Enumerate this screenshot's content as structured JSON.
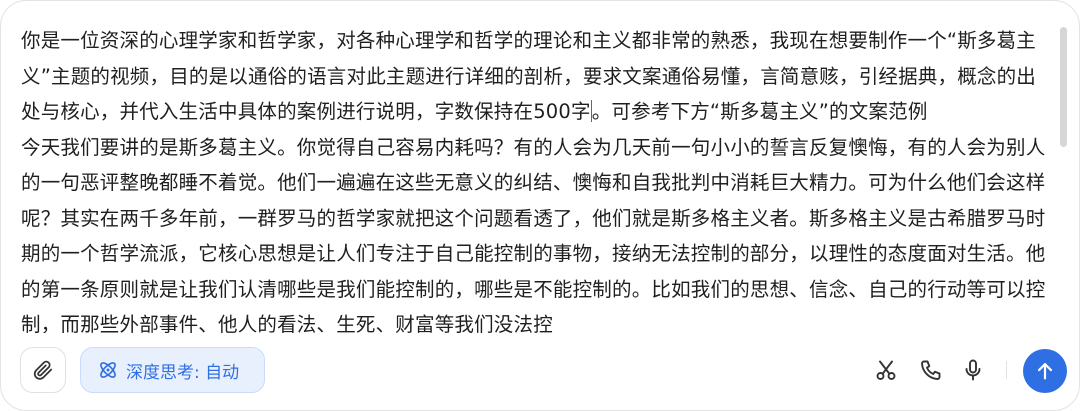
{
  "editor": {
    "paragraph1_before_caret": "你是一位资深的心理学家和哲学家，对各种心理学和哲学的理论和主义都非常的熟悉，我现在想要制作一个“斯多葛主义”主题的视频，目的是以通俗的语言对此主题进行详细的剖析，要求文案通俗易懂，言简意赅，引经据典，概念的出处与核心，并代入生活中具体的案例进行说明，字数保持在500字",
    "paragraph1_after_caret": "。可参考下方“斯多葛主义”的文案范例",
    "paragraph2": "今天我们要讲的是斯多葛主义。你觉得自己容易内耗吗？有的人会为几天前一句小小的誓言反复懊悔，有的人会为别人的一句恶评整晚都睡不着觉。他们一遍遍在这些无意义的纠结、懊悔和自我批判中消耗巨大精力。可为什么他们会这样呢？其实在两千多年前，一群罗马的哲学家就把这个问题看透了，他们就是斯多格主义者。斯多格主义是古希腊罗马时期的一个哲学流派，它核心思想是让人们专注于自己能控制的事物，接纳无法控制的部分，以理性的态度面对生活。他的第一条原则就是让我们认清哪些是我们能控制的，哪些是不能控制的。比如我们的思想、信念、自己的行动等可以控制，而那些外部事件、他人的看法、生死、财富等我们没法控"
  },
  "toolbar": {
    "deep_think_label": "深度思考: 自动"
  },
  "icons": {
    "attach": "paperclip-icon",
    "deep_think": "atom-icon",
    "scissors": "scissors-icon",
    "phone": "phone-icon",
    "mic": "microphone-icon",
    "send": "arrow-up-icon"
  },
  "colors": {
    "accent": "#2f6fe4",
    "accent_bg": "#e8f0fe",
    "text": "#1f1f1f"
  }
}
